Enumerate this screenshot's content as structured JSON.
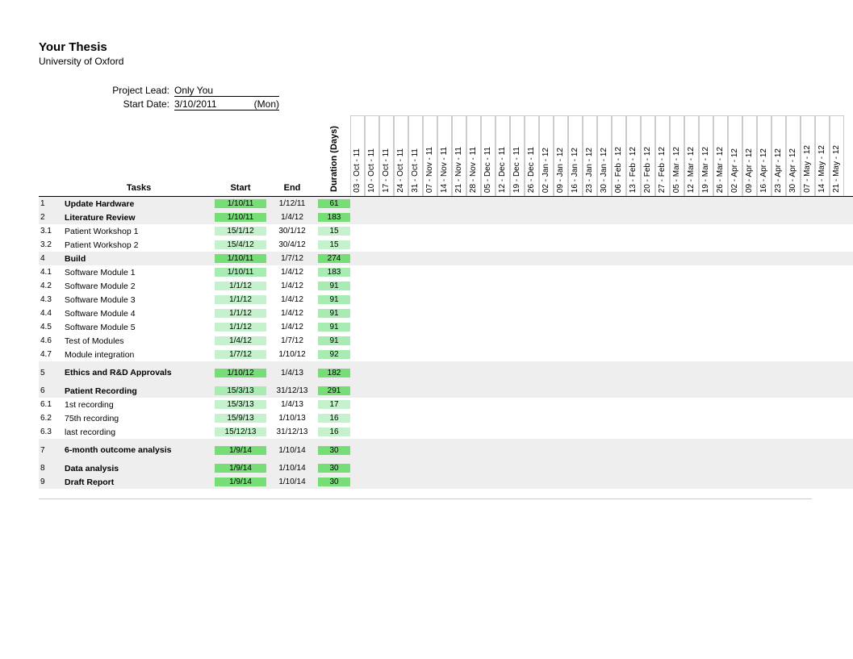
{
  "header": {
    "title": "Your Thesis",
    "subtitle": "University of Oxford"
  },
  "meta": {
    "lead_label": "Project Lead:",
    "lead_value": "Only You",
    "start_label": "Start Date:",
    "start_value": "3/10/2011",
    "start_day": "(Mon)"
  },
  "column_headers": {
    "tasks": "Tasks",
    "start": "Start",
    "end": "End",
    "duration": "Duration (Days)"
  },
  "date_columns": [
    "03 - Oct - 11",
    "10 - Oct - 11",
    "17 - Oct - 11",
    "24 - Oct - 11",
    "31 - Oct - 11",
    "07 - Nov - 11",
    "14 - Nov - 11",
    "21 - Nov - 11",
    "28 - Nov - 11",
    "05 - Dec - 11",
    "12 - Dec - 11",
    "19 - Dec - 11",
    "26 - Dec - 11",
    "02 - Jan - 12",
    "09 - Jan - 12",
    "16 - Jan - 12",
    "23 - Jan - 12",
    "30 - Jan - 12",
    "06 - Feb - 12",
    "13 - Feb - 12",
    "20 - Feb - 12",
    "27 - Feb - 12",
    "05 - Mar - 12",
    "12 - Mar - 12",
    "19 - Mar - 12",
    "26 - Mar - 12",
    "02 - Apr - 12",
    "09 - Apr - 12",
    "16 - Apr - 12",
    "23 - Apr - 12",
    "30 - Apr - 12",
    "07 - May - 12",
    "14 - May - 12",
    "21 - May - 12"
  ],
  "rows": [
    {
      "num": "1",
      "task": "Update Hardware",
      "start": "1/10/11",
      "end": "1/12/11",
      "dur": "61",
      "bold": true,
      "shaded": true,
      "sg": "g1",
      "dg": "g1"
    },
    {
      "num": "2",
      "task": "Literature Review",
      "start": "1/10/11",
      "end": "1/4/12",
      "dur": "183",
      "bold": true,
      "shaded": true,
      "sg": "g1",
      "dg": "g1"
    },
    {
      "num": "3.1",
      "task": "Patient Workshop 1",
      "start": "15/1/12",
      "end": "30/1/12",
      "dur": "15",
      "bold": false,
      "shaded": false,
      "sg": "g3",
      "dg": "g3"
    },
    {
      "num": "3.2",
      "task": "Patient Workshop 2",
      "start": "15/4/12",
      "end": "30/4/12",
      "dur": "15",
      "bold": false,
      "shaded": false,
      "sg": "g3",
      "dg": "g3"
    },
    {
      "num": "4",
      "task": "Build",
      "start": "1/10/11",
      "end": "1/7/12",
      "dur": "274",
      "bold": true,
      "shaded": true,
      "sg": "g1",
      "dg": "g1"
    },
    {
      "num": "4.1",
      "task": "Software Module 1",
      "start": "1/10/11",
      "end": "1/4/12",
      "dur": "183",
      "bold": false,
      "shaded": false,
      "sg": "g2",
      "dg": "g2"
    },
    {
      "num": "4.2",
      "task": "Software Module 2",
      "start": "1/1/12",
      "end": "1/4/12",
      "dur": "91",
      "bold": false,
      "shaded": false,
      "sg": "g3",
      "dg": "g2"
    },
    {
      "num": "4.3",
      "task": "Software Module 3",
      "start": "1/1/12",
      "end": "1/4/12",
      "dur": "91",
      "bold": false,
      "shaded": false,
      "sg": "g3",
      "dg": "g2"
    },
    {
      "num": "4.4",
      "task": "Software Module 4",
      "start": "1/1/12",
      "end": "1/4/12",
      "dur": "91",
      "bold": false,
      "shaded": false,
      "sg": "g3",
      "dg": "g2"
    },
    {
      "num": "4.5",
      "task": "Software Module 5",
      "start": "1/1/12",
      "end": "1/4/12",
      "dur": "91",
      "bold": false,
      "shaded": false,
      "sg": "g3",
      "dg": "g2"
    },
    {
      "num": "4.6",
      "task": "Test of Modules",
      "start": "1/4/12",
      "end": "1/7/12",
      "dur": "91",
      "bold": false,
      "shaded": false,
      "sg": "g3",
      "dg": "g2"
    },
    {
      "num": "4.7",
      "task": "Module integration",
      "start": "1/7/12",
      "end": "1/10/12",
      "dur": "92",
      "bold": false,
      "shaded": false,
      "sg": "g3",
      "dg": "g2"
    },
    {
      "num": "5",
      "task": "Ethics and R&D Approvals",
      "start": "1/10/12",
      "end": "1/4/13",
      "dur": "182",
      "bold": true,
      "shaded": true,
      "sg": "g1",
      "dg": "g1",
      "tall": true
    },
    {
      "num": "6",
      "task": "Patient Recording",
      "start": "15/3/13",
      "end": "31/12/13",
      "dur": "291",
      "bold": true,
      "shaded": true,
      "sg": "g2",
      "dg": "g1"
    },
    {
      "num": "6.1",
      "task": "1st recording",
      "start": "15/3/13",
      "end": "1/4/13",
      "dur": "17",
      "bold": false,
      "shaded": false,
      "sg": "g3",
      "dg": "g3"
    },
    {
      "num": "6.2",
      "task": "75th recording",
      "start": "15/9/13",
      "end": "1/10/13",
      "dur": "16",
      "bold": false,
      "shaded": false,
      "sg": "g3",
      "dg": "g3"
    },
    {
      "num": "6.3",
      "task": "last recording",
      "start": "15/12/13",
      "end": "31/12/13",
      "dur": "16",
      "bold": false,
      "shaded": false,
      "sg": "g3",
      "dg": "g3"
    },
    {
      "num": "7",
      "task": "6-month outcome analysis",
      "start": "1/9/14",
      "end": "1/10/14",
      "dur": "30",
      "bold": true,
      "shaded": true,
      "sg": "g1",
      "dg": "g1",
      "tall": true
    },
    {
      "num": "8",
      "task": "Data analysis",
      "start": "1/9/14",
      "end": "1/10/14",
      "dur": "30",
      "bold": true,
      "shaded": true,
      "sg": "g1",
      "dg": "g1"
    },
    {
      "num": "9",
      "task": "Draft Report",
      "start": "1/9/14",
      "end": "1/10/14",
      "dur": "30",
      "bold": true,
      "shaded": true,
      "sg": "g1",
      "dg": "g1"
    }
  ]
}
